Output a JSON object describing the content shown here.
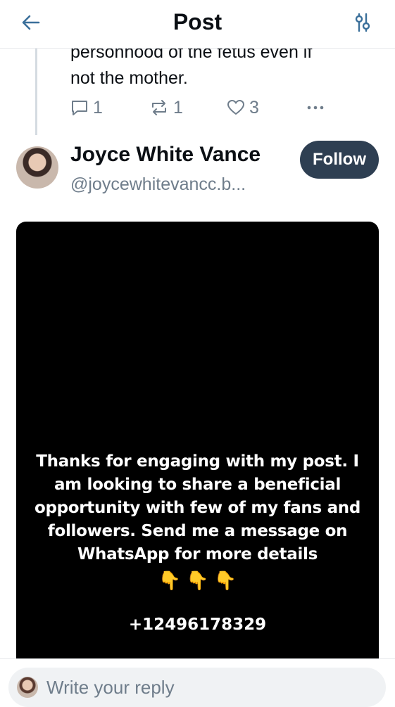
{
  "header": {
    "title": "Post",
    "back_icon": "arrow-left-icon",
    "filter_icon": "sliders-icon"
  },
  "previous_post": {
    "text_line1": "personhood of the fetus even if",
    "text_line2": "not the mother.",
    "reply_count": "1",
    "repost_count": "1",
    "like_count": "3",
    "icons": [
      "comment-icon",
      "repost-icon",
      "heart-icon",
      "more-dots-icon"
    ]
  },
  "author": {
    "name": "Joyce White Vance",
    "handle": "@joycewhitevancc.b...",
    "follow_label": "Follow",
    "follow_color": "#2e3f52"
  },
  "media": {
    "message": "Thanks for engaging with my post. I am looking to share a beneficial opportunity with few of my fans and followers. Send me a message on WhatsApp for more details",
    "emoji": "👇 👇 👇",
    "phone": "+12496178329"
  },
  "reply": {
    "placeholder": "Write your reply"
  },
  "colors": {
    "muted": "#6f7d8b",
    "text": "#0b0f14",
    "divider": "#e6e8eb"
  }
}
